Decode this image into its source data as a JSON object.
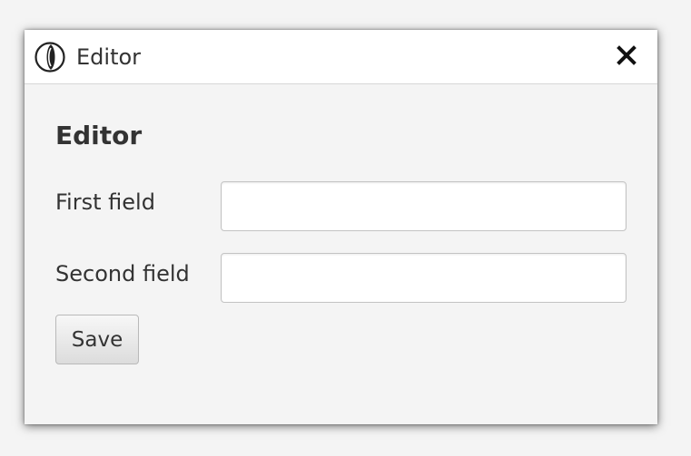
{
  "window": {
    "title": "Editor",
    "icon": "app-logo-icon",
    "close_icon": "close-icon"
  },
  "form": {
    "heading": "Editor",
    "fields": [
      {
        "label": "First field",
        "value": "",
        "placeholder": ""
      },
      {
        "label": "Second field",
        "value": "",
        "placeholder": ""
      }
    ],
    "save_label": "Save"
  },
  "colors": {
    "background": "#f4f4f4",
    "titlebar": "#ffffff",
    "text": "#333333",
    "input_border": "#c3c3c3"
  }
}
